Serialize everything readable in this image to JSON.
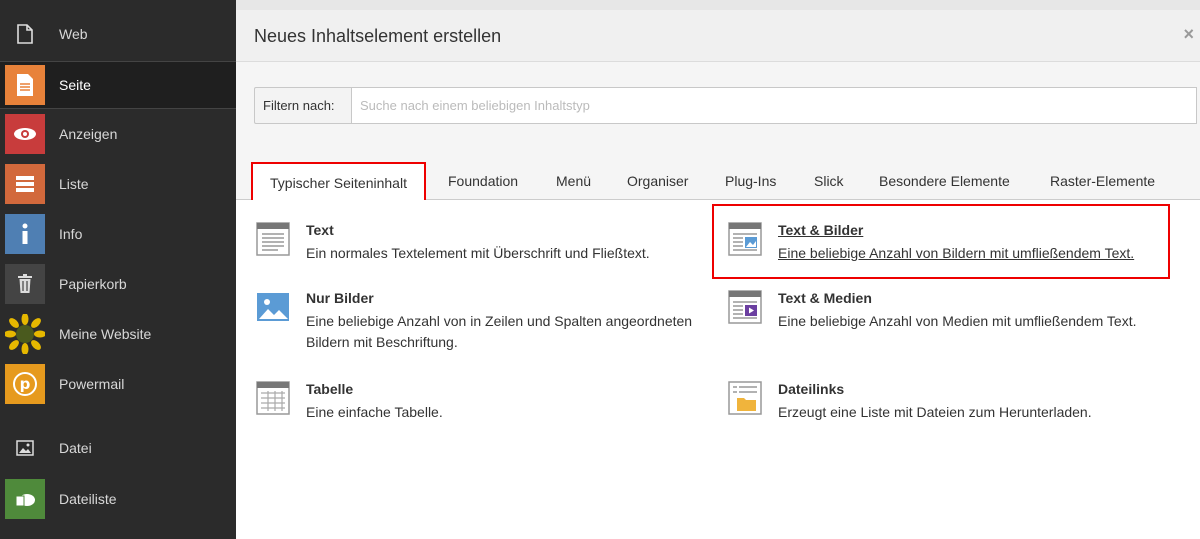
{
  "sidebar": {
    "items": [
      {
        "label": "Web",
        "icon": "page-outline-icon"
      },
      {
        "label": "Seite",
        "icon": "page-icon"
      },
      {
        "label": "Anzeigen",
        "icon": "eye-icon"
      },
      {
        "label": "Liste",
        "icon": "list-icon"
      },
      {
        "label": "Info",
        "icon": "info-icon"
      },
      {
        "label": "Papierkorb",
        "icon": "trash-icon"
      },
      {
        "label": "Meine Website",
        "icon": "sunflower-icon"
      },
      {
        "label": "Powermail",
        "icon": "powermail-icon"
      },
      {
        "label": "Datei",
        "icon": "image-icon"
      },
      {
        "label": "Dateiliste",
        "icon": "filelist-icon"
      }
    ]
  },
  "modal": {
    "title": "Neues Inhaltselement erstellen",
    "close": "×",
    "filter_label": "Filtern nach:",
    "filter_placeholder": "Suche nach einem beliebigen Inhaltstyp",
    "tabs": [
      "Typischer Seiteninhalt",
      "Foundation",
      "Menü",
      "Organiser",
      "Plug-Ins",
      "Slick",
      "Besondere Elemente",
      "Raster-Elemente"
    ],
    "elements": [
      {
        "title": "Text",
        "desc": "Ein normales Textelement mit Überschrift und Fließtext.",
        "icon": "text-icon"
      },
      {
        "title": "Text & Bilder",
        "desc": "Eine beliebige Anzahl von Bildern mit umfließendem Text.",
        "icon": "textpic-icon"
      },
      {
        "title": "Nur Bilder",
        "desc": "Eine beliebige Anzahl von in Zeilen und Spalten angeordneten",
        "desc2": "Bildern mit Beschriftung.",
        "icon": "images-icon"
      },
      {
        "title": "Text & Medien",
        "desc": "Eine beliebige Anzahl von Medien mit umfließendem Text.",
        "icon": "textmedia-icon"
      },
      {
        "title": "Tabelle",
        "desc": "Eine einfache Tabelle.",
        "icon": "table-icon"
      },
      {
        "title": "Dateilinks",
        "desc": "Erzeugt eine Liste mit Dateien zum Herunterladen.",
        "icon": "filelinks-icon"
      }
    ]
  },
  "colors": {
    "highlight": "#e00000",
    "seite": "#e8823a",
    "anzeigen": "#c83c3c",
    "liste": "#d2693c",
    "info": "#4f7fb3",
    "dateiliste": "#4f8a3b"
  }
}
